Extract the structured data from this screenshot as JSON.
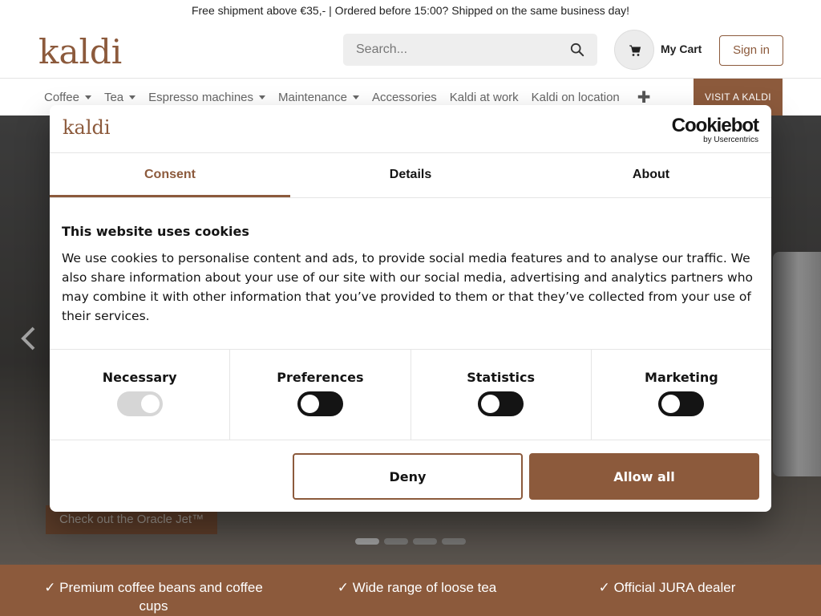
{
  "topbar": {
    "text": "Free shipment above €35,- | Ordered before 15:00? Shipped on the same business day!"
  },
  "header": {
    "logo": "kaldi",
    "search_placeholder": "Search...",
    "cart_label": "My Cart",
    "signin_label": "Sign in"
  },
  "nav": {
    "items": [
      {
        "label": "Coffee",
        "dropdown": true
      },
      {
        "label": "Tea",
        "dropdown": true
      },
      {
        "label": "Espresso machines",
        "dropdown": true
      },
      {
        "label": "Maintenance",
        "dropdown": true
      },
      {
        "label": "Accessories",
        "dropdown": false
      },
      {
        "label": "Kaldi at work",
        "dropdown": false
      },
      {
        "label": "Kaldi on location",
        "dropdown": false
      }
    ],
    "plus": "✚",
    "visit_label": "VISIT A KALDI"
  },
  "hero": {
    "cta_label": "Check out the Oracle Jet™",
    "slide_count": 4,
    "active_slide": 1
  },
  "usps": {
    "items": [
      "✓ Premium coffee beans and coffee cups",
      "✓ Wide range of loose tea",
      "✓ Official JURA dealer"
    ]
  },
  "cookie_dialog": {
    "logo": "kaldi",
    "brand_name": "Cookiebot",
    "brand_sub": "by Usercentrics",
    "tabs": [
      {
        "label": "Consent",
        "active": true
      },
      {
        "label": "Details",
        "active": false
      },
      {
        "label": "About",
        "active": false
      }
    ],
    "title": "This website uses cookies",
    "body": "We use cookies to personalise content and ads, to provide social media features and to analyse our traffic. We also share information about your use of our site with our social media, advertising and analytics partners who may combine it with other information that you’ve provided to them or that they’ve collected from your use of their services.",
    "toggles": [
      {
        "label": "Necessary",
        "on": true,
        "disabled": true
      },
      {
        "label": "Preferences",
        "on": false,
        "disabled": false
      },
      {
        "label": "Statistics",
        "on": false,
        "disabled": false
      },
      {
        "label": "Marketing",
        "on": false,
        "disabled": false
      }
    ],
    "deny_label": "Deny",
    "allow_label": "Allow all"
  },
  "colors": {
    "brand": "#8c5a3c",
    "text": "#141414"
  }
}
